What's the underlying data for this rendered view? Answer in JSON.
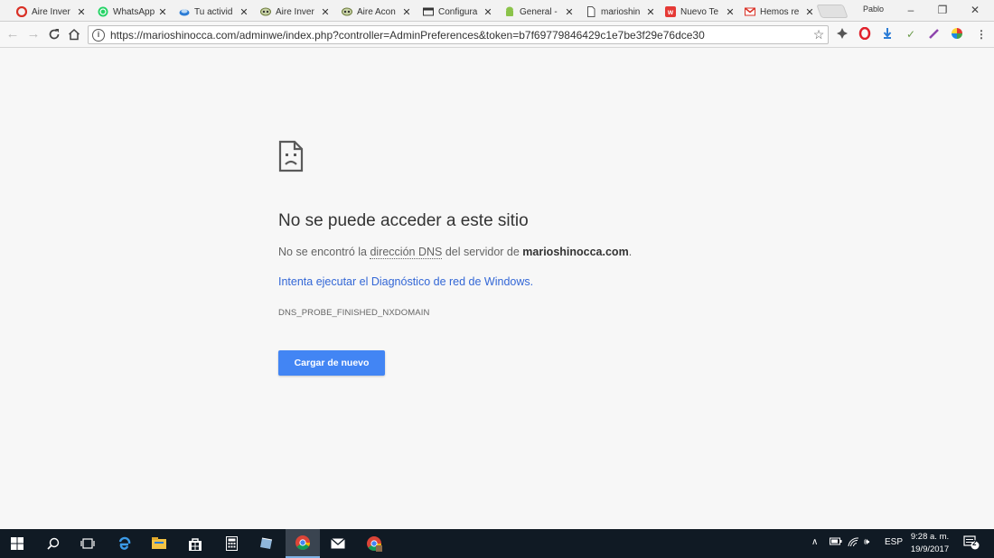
{
  "tabs": [
    {
      "title": "Aire Inver",
      "favicon": "opera-o-icon",
      "color": "#d93025"
    },
    {
      "title": "WhatsApp",
      "favicon": "whatsapp-icon",
      "color": "#25d366"
    },
    {
      "title": "Tu activid",
      "favicon": "cloud-icon",
      "color": "#2a7bd5"
    },
    {
      "title": "Aire Inver",
      "favicon": "mask-icon",
      "color": "#8a9a5b"
    },
    {
      "title": "Aire Acon",
      "favicon": "mask-icon",
      "color": "#8a9a5b"
    },
    {
      "title": "Configura",
      "favicon": "window-icon",
      "color": "#333333"
    },
    {
      "title": "General -",
      "favicon": "android-icon",
      "color": "#8bc34a"
    },
    {
      "title": "marioshin",
      "favicon": "page-icon",
      "color": "#555555"
    },
    {
      "title": "Nuevo Te",
      "favicon": "w-icon",
      "color": "#e53935"
    },
    {
      "title": "Hemos re",
      "favicon": "gmail-icon",
      "color": "#d93025"
    }
  ],
  "profile_name": "Pablo",
  "window_controls": {
    "minimize": "–",
    "restore": "❐",
    "close": "✕"
  },
  "address_bar": {
    "url": "https://marioshinocca.com/adminwe/index.php?controller=AdminPreferences&token=b7f69779846429c1e7be3f29e76dce30"
  },
  "error_page": {
    "title": "No se puede acceder a este sitio",
    "desc_prefix": "No se encontró la ",
    "desc_term": "dirección DNS",
    "desc_middle": " del servidor de ",
    "desc_host": "marioshinocca.com",
    "desc_suffix": ".",
    "diagnostic_link": "Intenta ejecutar el Diagnóstico de red de Windows.",
    "error_code": "DNS_PROBE_FINISHED_NXDOMAIN",
    "reload_button": "Cargar de nuevo"
  },
  "taskbar": {
    "language": "ESP",
    "time": "9:28 a. m.",
    "date": "19/9/2017",
    "notification_count": "2"
  }
}
